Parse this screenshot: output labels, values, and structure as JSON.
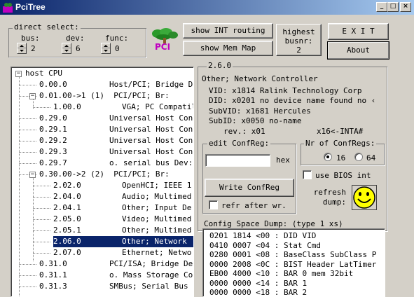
{
  "window": {
    "title": "PciTree",
    "icon_label": "PCI"
  },
  "direct_select": {
    "label": "direct select:",
    "bus": {
      "label": "bus:",
      "value": "2"
    },
    "dev": {
      "label": "dev:",
      "value": "6"
    },
    "func": {
      "label": "func:",
      "value": "0"
    }
  },
  "logo": {
    "text": "PCI"
  },
  "buttons": {
    "show_int": "show INT routing",
    "show_mem": "show Mem Map",
    "exit": "E X I T",
    "about": "About",
    "write_confreg": "Write ConfReg"
  },
  "highest_busnr": {
    "label1": "highest",
    "label2": "busnr:",
    "value": "2"
  },
  "version": "2.6.0",
  "device": {
    "class": "Other; Network Controller",
    "vid": "VID: x1814 Ralink Technology Corp",
    "did": "DID: x0201 no device name found no ‹",
    "subvid": "SubVID: x1681 Hercules",
    "subid": "SubID:  x0050 no-name",
    "rev": "rev.: x01",
    "int": "x16<-INTA#"
  },
  "edit_confreg": {
    "label": "edit ConfReg:",
    "value": "",
    "suffix": "hex",
    "refr_label": "refr after wr."
  },
  "nr_confregs": {
    "label": "Nr of ConfRegs:",
    "opt16": "16",
    "opt64": "64"
  },
  "bios": {
    "label": "use BIOS int"
  },
  "refresh": {
    "label1": "refresh",
    "label2": "dump:"
  },
  "dump": {
    "label": "Config Space Dump: (type 1 xs)",
    "rows": [
      "0201 1814 <00 : DID VID",
      "0410 0007 <04 : Stat Cmd",
      "0280 0001 <08 : BaseClass SubClass P",
      "0000 2008 <0C : BIST Header LatTimer",
      "EB00 4000 <10 : BAR 0 mem 32bit",
      "0000 0000 <14 : BAR 1",
      "0000 0000 <18 : BAR 2"
    ]
  },
  "tree": [
    {
      "id": "host CPU",
      "desc": ""
    },
    {
      "id": "0.00.0",
      "desc": "Host/PCI; Bridge D"
    },
    {
      "id": "0.01.0",
      "desc": "0->1 (1)  PCI/PCI; Br:"
    },
    {
      "id": "1.00.0",
      "desc": "VGA; PC Compatil"
    },
    {
      "id": "0.29.0",
      "desc": "Universal Host Con"
    },
    {
      "id": "0.29.1",
      "desc": "Universal Host Con"
    },
    {
      "id": "0.29.2",
      "desc": "Universal Host Con"
    },
    {
      "id": "0.29.3",
      "desc": "Universal Host Con"
    },
    {
      "id": "0.29.7",
      "desc": "o. serial bus Dev:"
    },
    {
      "id": "0.30.0",
      "desc": "0->2 (2)  PCI/PCI; Br:"
    },
    {
      "id": "2.02.0",
      "desc": "OpenHCI; IEEE 1"
    },
    {
      "id": "2.04.0",
      "desc": "Audio; Multimed"
    },
    {
      "id": "2.04.1",
      "desc": "Other; Input De"
    },
    {
      "id": "2.05.0",
      "desc": "Video; Multimed"
    },
    {
      "id": "2.05.1",
      "desc": "Other; Multimed"
    },
    {
      "id": "2.06.0",
      "desc": "Other; Network"
    },
    {
      "id": "2.07.0",
      "desc": "Ethernet; Netwo"
    },
    {
      "id": "0.31.0",
      "desc": "PCI/ISA; Bridge De"
    },
    {
      "id": "0.31.1",
      "desc": "o. Mass Storage Co"
    },
    {
      "id": "0.31.3",
      "desc": "SMBus; Serial Bus"
    }
  ]
}
